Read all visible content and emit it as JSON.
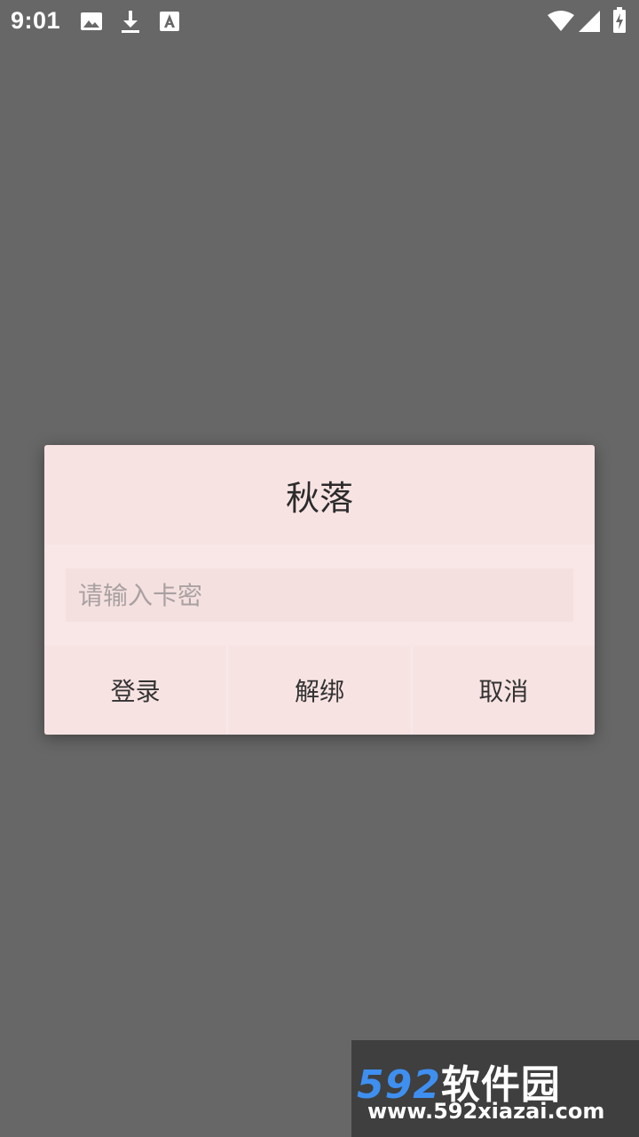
{
  "status_bar": {
    "time": "9:01",
    "left_icons": [
      "image-icon",
      "download-icon",
      "text-a-icon"
    ],
    "right_icons": [
      "wifi-icon",
      "signal-icon",
      "battery-icon"
    ]
  },
  "dialog": {
    "title": "秋落",
    "input": {
      "value": "",
      "placeholder": "请输入卡密"
    },
    "buttons": {
      "login": "登录",
      "unbind": "解绑",
      "cancel": "取消"
    }
  },
  "watermark": {
    "logo_number": "592",
    "logo_text": "软件园",
    "url": "www.592xiazai.com"
  },
  "colors": {
    "overlay": "#676767",
    "dialog_bg": "#f8e3e3",
    "logo_blue": "#3e8ff0"
  }
}
